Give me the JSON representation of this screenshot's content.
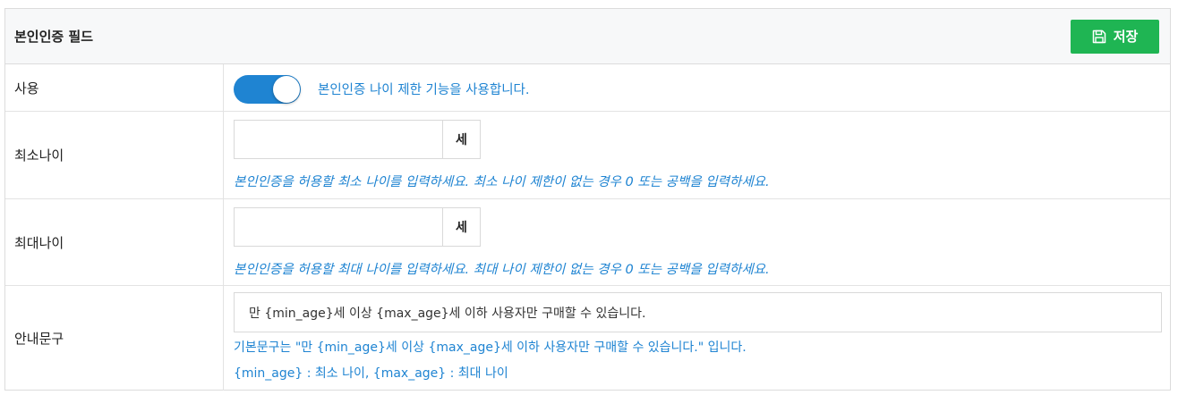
{
  "panel": {
    "title": "본인인증 필드",
    "save_label": "저장",
    "save_icon": "floppy-disk-icon"
  },
  "colors": {
    "accent": "#1f84d2",
    "save_button": "#1fb553",
    "header_bg": "#f7f8f9"
  },
  "rows": {
    "use": {
      "label": "사용",
      "toggle_on": true,
      "description": "본인인증 나이 제한 기능을 사용합니다."
    },
    "min_age": {
      "label": "최소나이",
      "value": "",
      "unit": "세",
      "help": "본인인증을 허용할 최소 나이를 입력하세요. 최소 나이 제한이 없는 경우 0 또는 공백을 입력하세요."
    },
    "max_age": {
      "label": "최대나이",
      "value": "",
      "unit": "세",
      "help": "본인인증을 허용할 최대 나이를 입력하세요. 최대 나이 제한이 없는 경우 0 또는 공백을 입력하세요."
    },
    "guide": {
      "label": "안내문구",
      "value": "만 {min_age}세 이상 {max_age}세 이하 사용자만 구매할 수 있습니다.",
      "help_default": "기본문구는 \"만 {min_age}세 이상 {max_age}세 이하 사용자만 구매할 수 있습니다.\" 입니다.",
      "help_vars": "{min_age} : 최소 나이, {max_age} : 최대 나이"
    }
  }
}
